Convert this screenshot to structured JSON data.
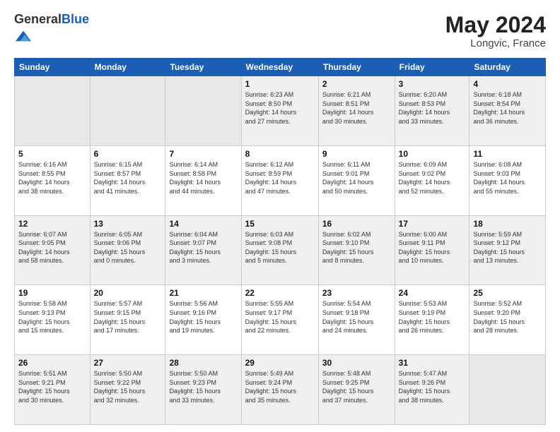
{
  "header": {
    "logo_general": "General",
    "logo_blue": "Blue",
    "month_title": "May 2024",
    "location": "Longvic, France"
  },
  "weekdays": [
    "Sunday",
    "Monday",
    "Tuesday",
    "Wednesday",
    "Thursday",
    "Friday",
    "Saturday"
  ],
  "weeks": [
    [
      {
        "day": "",
        "info": ""
      },
      {
        "day": "",
        "info": ""
      },
      {
        "day": "",
        "info": ""
      },
      {
        "day": "1",
        "info": "Sunrise: 6:23 AM\nSunset: 8:50 PM\nDaylight: 14 hours\nand 27 minutes."
      },
      {
        "day": "2",
        "info": "Sunrise: 6:21 AM\nSunset: 8:51 PM\nDaylight: 14 hours\nand 30 minutes."
      },
      {
        "day": "3",
        "info": "Sunrise: 6:20 AM\nSunset: 8:53 PM\nDaylight: 14 hours\nand 33 minutes."
      },
      {
        "day": "4",
        "info": "Sunrise: 6:18 AM\nSunset: 8:54 PM\nDaylight: 14 hours\nand 36 minutes."
      }
    ],
    [
      {
        "day": "5",
        "info": "Sunrise: 6:16 AM\nSunset: 8:55 PM\nDaylight: 14 hours\nand 38 minutes."
      },
      {
        "day": "6",
        "info": "Sunrise: 6:15 AM\nSunset: 8:57 PM\nDaylight: 14 hours\nand 41 minutes."
      },
      {
        "day": "7",
        "info": "Sunrise: 6:14 AM\nSunset: 8:58 PM\nDaylight: 14 hours\nand 44 minutes."
      },
      {
        "day": "8",
        "info": "Sunrise: 6:12 AM\nSunset: 8:59 PM\nDaylight: 14 hours\nand 47 minutes."
      },
      {
        "day": "9",
        "info": "Sunrise: 6:11 AM\nSunset: 9:01 PM\nDaylight: 14 hours\nand 50 minutes."
      },
      {
        "day": "10",
        "info": "Sunrise: 6:09 AM\nSunset: 9:02 PM\nDaylight: 14 hours\nand 52 minutes."
      },
      {
        "day": "11",
        "info": "Sunrise: 6:08 AM\nSunset: 9:03 PM\nDaylight: 14 hours\nand 55 minutes."
      }
    ],
    [
      {
        "day": "12",
        "info": "Sunrise: 6:07 AM\nSunset: 9:05 PM\nDaylight: 14 hours\nand 58 minutes."
      },
      {
        "day": "13",
        "info": "Sunrise: 6:05 AM\nSunset: 9:06 PM\nDaylight: 15 hours\nand 0 minutes."
      },
      {
        "day": "14",
        "info": "Sunrise: 6:04 AM\nSunset: 9:07 PM\nDaylight: 15 hours\nand 3 minutes."
      },
      {
        "day": "15",
        "info": "Sunrise: 6:03 AM\nSunset: 9:08 PM\nDaylight: 15 hours\nand 5 minutes."
      },
      {
        "day": "16",
        "info": "Sunrise: 6:02 AM\nSunset: 9:10 PM\nDaylight: 15 hours\nand 8 minutes."
      },
      {
        "day": "17",
        "info": "Sunrise: 6:00 AM\nSunset: 9:11 PM\nDaylight: 15 hours\nand 10 minutes."
      },
      {
        "day": "18",
        "info": "Sunrise: 5:59 AM\nSunset: 9:12 PM\nDaylight: 15 hours\nand 13 minutes."
      }
    ],
    [
      {
        "day": "19",
        "info": "Sunrise: 5:58 AM\nSunset: 9:13 PM\nDaylight: 15 hours\nand 15 minutes."
      },
      {
        "day": "20",
        "info": "Sunrise: 5:57 AM\nSunset: 9:15 PM\nDaylight: 15 hours\nand 17 minutes."
      },
      {
        "day": "21",
        "info": "Sunrise: 5:56 AM\nSunset: 9:16 PM\nDaylight: 15 hours\nand 19 minutes."
      },
      {
        "day": "22",
        "info": "Sunrise: 5:55 AM\nSunset: 9:17 PM\nDaylight: 15 hours\nand 22 minutes."
      },
      {
        "day": "23",
        "info": "Sunrise: 5:54 AM\nSunset: 9:18 PM\nDaylight: 15 hours\nand 24 minutes."
      },
      {
        "day": "24",
        "info": "Sunrise: 5:53 AM\nSunset: 9:19 PM\nDaylight: 15 hours\nand 26 minutes."
      },
      {
        "day": "25",
        "info": "Sunrise: 5:52 AM\nSunset: 9:20 PM\nDaylight: 15 hours\nand 28 minutes."
      }
    ],
    [
      {
        "day": "26",
        "info": "Sunrise: 5:51 AM\nSunset: 9:21 PM\nDaylight: 15 hours\nand 30 minutes."
      },
      {
        "day": "27",
        "info": "Sunrise: 5:50 AM\nSunset: 9:22 PM\nDaylight: 15 hours\nand 32 minutes."
      },
      {
        "day": "28",
        "info": "Sunrise: 5:50 AM\nSunset: 9:23 PM\nDaylight: 15 hours\nand 33 minutes."
      },
      {
        "day": "29",
        "info": "Sunrise: 5:49 AM\nSunset: 9:24 PM\nDaylight: 15 hours\nand 35 minutes."
      },
      {
        "day": "30",
        "info": "Sunrise: 5:48 AM\nSunset: 9:25 PM\nDaylight: 15 hours\nand 37 minutes."
      },
      {
        "day": "31",
        "info": "Sunrise: 5:47 AM\nSunset: 9:26 PM\nDaylight: 15 hours\nand 38 minutes."
      },
      {
        "day": "",
        "info": ""
      }
    ]
  ]
}
